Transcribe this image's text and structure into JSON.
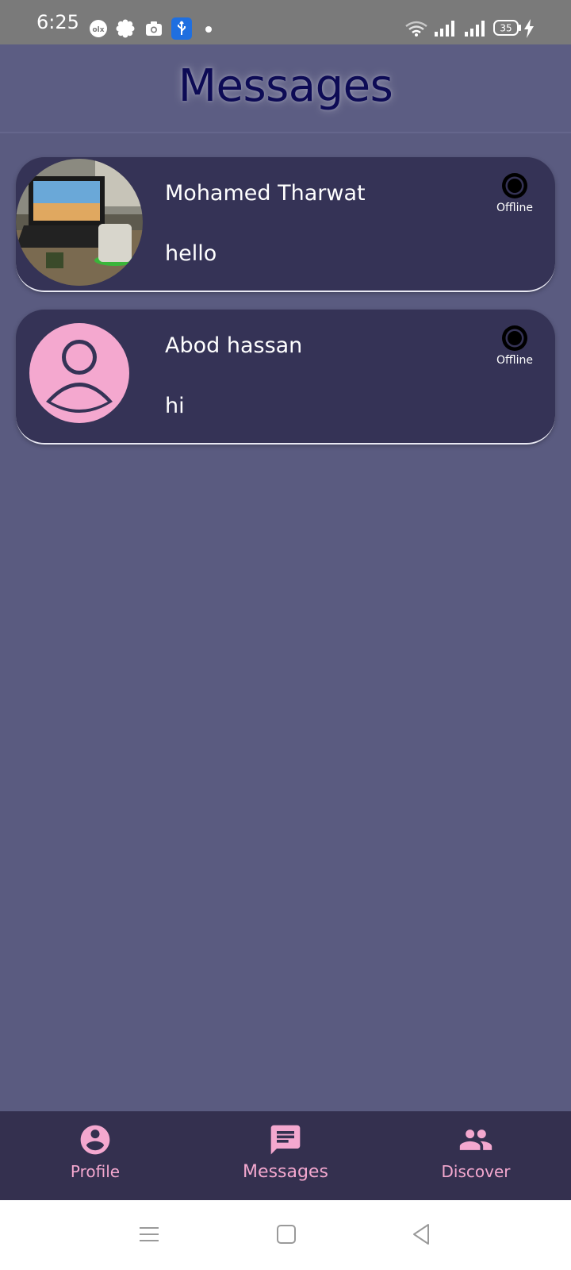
{
  "status_bar": {
    "time": "6:25",
    "battery": "35",
    "icons": [
      "olx-icon",
      "gear-flower-icon",
      "camera-icon",
      "usb-icon",
      "dot-icon",
      "wifi-icon",
      "signal-icon",
      "signal-icon",
      "battery-icon",
      "charging-icon"
    ]
  },
  "header": {
    "title": "Messages"
  },
  "conversations": [
    {
      "name": "Mohamed Tharwat",
      "last_message": "hello",
      "status": "Offline",
      "avatar": "photo-laptop-desk"
    },
    {
      "name": "Abod hassan",
      "last_message": "hi",
      "status": "Offline",
      "avatar": "default-user-icon"
    }
  ],
  "bottom_nav": {
    "items": [
      {
        "label": "Profile",
        "icon": "account-circle-icon"
      },
      {
        "label": "Messages",
        "icon": "chat-icon",
        "active": true
      },
      {
        "label": "Discover",
        "icon": "people-icon"
      }
    ]
  },
  "colors": {
    "background": "#5a5b80",
    "card": "#353356",
    "nav": "#34304f",
    "accent": "#f4a8cf",
    "title": "#0d0b55"
  }
}
